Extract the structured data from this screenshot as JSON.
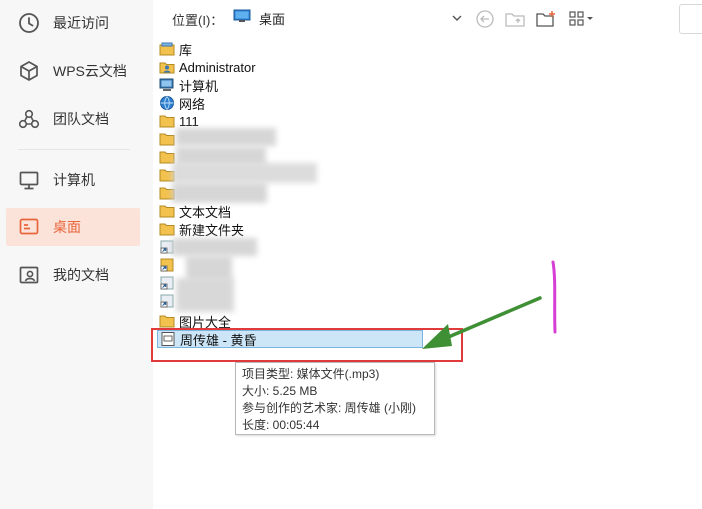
{
  "sidebar": {
    "items": [
      {
        "label": "最近访问",
        "icon": "clock-icon"
      },
      {
        "label": "WPS云文档",
        "icon": "cloud-cube-icon"
      },
      {
        "label": "团队文档",
        "icon": "team-icon"
      },
      {
        "label": "计算机",
        "icon": "monitor-icon"
      },
      {
        "label": "桌面",
        "icon": "desktop-icon",
        "active": true
      },
      {
        "label": "我的文档",
        "icon": "user-docs-icon"
      }
    ],
    "active_color": "#e8653c"
  },
  "toolbar": {
    "location_label": "位置(I)：",
    "location_value": "桌面"
  },
  "files": [
    {
      "name": "库",
      "icon": "library-icon"
    },
    {
      "name": "Administrator",
      "icon": "user-folder-icon"
    },
    {
      "name": "计算机",
      "icon": "computer-icon"
    },
    {
      "name": "网络",
      "icon": "network-icon"
    },
    {
      "name": "111",
      "icon": "folder-icon"
    },
    {
      "name": "",
      "icon": "folder-icon"
    },
    {
      "name": "",
      "icon": "folder-icon"
    },
    {
      "name": "",
      "icon": "folder-icon"
    },
    {
      "name": "",
      "icon": "folder-icon"
    },
    {
      "name": "文本文档",
      "icon": "folder-icon"
    },
    {
      "name": "新建文件夹",
      "icon": "folder-icon"
    },
    {
      "name": "",
      "icon": "shortcut-icon"
    },
    {
      "name": "",
      "icon": "shortcut-icon"
    },
    {
      "name": "",
      "icon": "shortcut-icon"
    },
    {
      "name": "",
      "icon": "shortcut-icon"
    },
    {
      "name": "图片大全",
      "icon": "folder-icon"
    },
    {
      "name": "周传雄 - 黄昏",
      "icon": "media-file-icon",
      "selected": true
    }
  ],
  "tooltip": {
    "type_line": "项目类型: 媒体文件(.mp3)",
    "size_line": "大小: 5.25 MB",
    "artist_line": "参与创作的艺术家: 周传雄 (小刚)",
    "length_line": "长度: 00:05:44"
  },
  "annotation_colors": {
    "box": "#e03a3a",
    "arrow": "#3f8f35",
    "mark": "#d63fd6"
  }
}
